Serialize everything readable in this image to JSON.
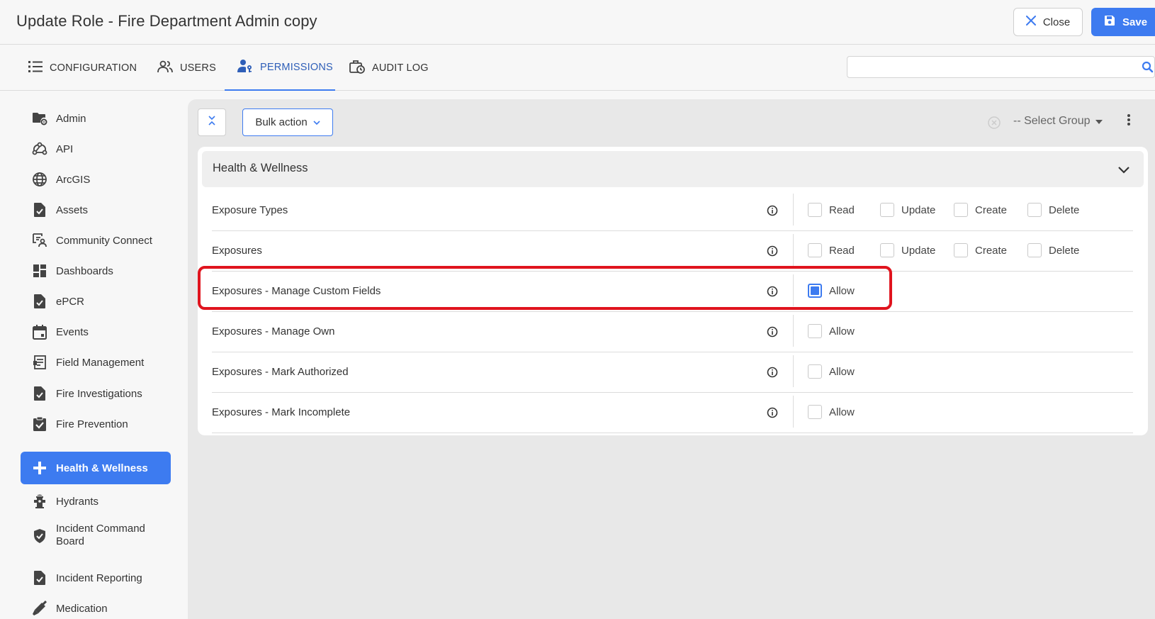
{
  "header": {
    "title": "Update Role - Fire Department Admin copy",
    "close_label": "Close",
    "save_label": "Save"
  },
  "tabs": [
    {
      "label": "CONFIGURATION",
      "icon": "list-icon"
    },
    {
      "label": "USERS",
      "icon": "users-icon"
    },
    {
      "label": "PERMISSIONS",
      "icon": "user-key-icon",
      "active": true
    },
    {
      "label": "AUDIT LOG",
      "icon": "briefcase-clock-icon"
    }
  ],
  "search": {
    "placeholder": ""
  },
  "sidebar": {
    "items": [
      {
        "label": "Admin",
        "icon": "folder-gear-icon"
      },
      {
        "label": "API",
        "icon": "webhook-icon"
      },
      {
        "label": "ArcGIS",
        "icon": "globe-icon"
      },
      {
        "label": "Assets",
        "icon": "document-check-icon"
      },
      {
        "label": "Community Connect",
        "icon": "community-icon"
      },
      {
        "label": "Dashboards",
        "icon": "dashboard-icon"
      },
      {
        "label": "ePCR",
        "icon": "document-check-icon"
      },
      {
        "label": "Events",
        "icon": "calendar-icon"
      },
      {
        "label": "Field Management",
        "icon": "form-icon"
      },
      {
        "label": "Fire Investigations",
        "icon": "document-check-icon"
      },
      {
        "label": "Fire Prevention",
        "icon": "clipboard-check-icon"
      },
      {
        "label": "Health & Wellness",
        "icon": "plus-icon",
        "active": true
      },
      {
        "label": "Hydrants",
        "icon": "hydrant-icon"
      },
      {
        "label": "Incident Command Board",
        "icon": "shield-check-icon"
      },
      {
        "label": "Incident Reporting",
        "icon": "document-check-icon"
      },
      {
        "label": "Medication",
        "icon": "syringe-icon"
      }
    ]
  },
  "toolbar": {
    "bulk_label": "Bulk action",
    "select_group": "-- Select Group"
  },
  "group": {
    "title": "Health & Wellness",
    "rows": [
      {
        "label": "Exposure Types",
        "perms": [
          {
            "label": "Read",
            "checked": false
          },
          {
            "label": "Update",
            "checked": false
          },
          {
            "label": "Create",
            "checked": false
          },
          {
            "label": "Delete",
            "checked": false
          }
        ]
      },
      {
        "label": "Exposures",
        "perms": [
          {
            "label": "Read",
            "checked": false
          },
          {
            "label": "Update",
            "checked": false
          },
          {
            "label": "Create",
            "checked": false
          },
          {
            "label": "Delete",
            "checked": false
          }
        ]
      },
      {
        "label": "Exposures - Manage Custom Fields",
        "perms": [
          {
            "label": "Allow",
            "checked": true
          }
        ]
      },
      {
        "label": "Exposures - Manage Own",
        "perms": [
          {
            "label": "Allow",
            "checked": false
          }
        ]
      },
      {
        "label": "Exposures - Mark Authorized",
        "perms": [
          {
            "label": "Allow",
            "checked": false
          }
        ]
      },
      {
        "label": "Exposures - Mark Incomplete",
        "perms": [
          {
            "label": "Allow",
            "checked": false
          }
        ]
      }
    ]
  },
  "colors": {
    "accent": "#3d7bf0",
    "highlight": "#e0141e"
  }
}
